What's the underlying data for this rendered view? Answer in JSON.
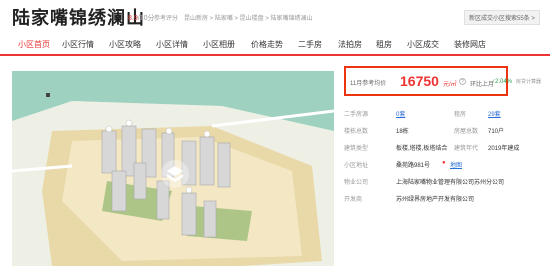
{
  "header": {
    "title": "陆家嘴锦绣澜山",
    "score": "8.9",
    "score_unit": "/10分",
    "score_label": "参考评分",
    "breadcrumb": "昆山新房 > 陆家嘴 > 昆山楼盘 > 陆家嘴锦绣澜山",
    "search_tag": "新区成交小区搜索55条 >"
  },
  "nav": {
    "items": [
      "小区首页",
      "小区行情",
      "小区攻略",
      "小区详情",
      "小区相册",
      "价格走势",
      "二手房",
      "法拍房",
      "租房",
      "小区成交",
      "装修网店"
    ],
    "active": "小区首页"
  },
  "price": {
    "label": "11月参考均价",
    "value": "16750",
    "unit": "元/㎡",
    "mom_label": "环比上月",
    "mom_value": "↑2.04%",
    "calc_link": "房贷计算器"
  },
  "details": {
    "secondhand_label": "二手房源",
    "secondhand_value": "0套",
    "rent_label": "租房",
    "rent_value": "29套",
    "buildings_label": "楼栋总数",
    "buildings_value": "18栋",
    "households_label": "房屋总数",
    "households_value": "710户",
    "type_label": "建筑类型",
    "type_value": "板楼,塔楼,板塔结合",
    "year_label": "建筑年代",
    "year_value": "2019年建成",
    "address_label": "小区地址",
    "address_value": "桑苑路981号",
    "map_link": "地图",
    "property_label": "物业公司",
    "property_value": "上海陆家嘴物业管理有限公司苏州分公司",
    "developer_label": "开发商",
    "developer_value": "苏州绿界房地产开发有限公司"
  },
  "colors": {
    "accent": "#e33333",
    "green": "#2a9d4a",
    "link": "#2a6fd6"
  }
}
